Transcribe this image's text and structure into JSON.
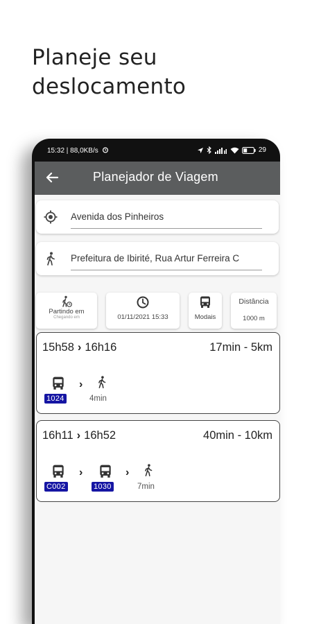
{
  "headline": {
    "line1": "Planeje seu",
    "line2": "deslocamento"
  },
  "status_bar": {
    "left": "15:32 | 88,0KB/s",
    "battery": "29"
  },
  "app_bar": {
    "title": "Planejador de Viagem"
  },
  "origin": {
    "value": "Avenida dos Pinheiros",
    "icon": "my-location-icon"
  },
  "destination": {
    "value": "Prefeitura de Ibirité, Rua Artur Ferreira C",
    "icon": "walking-icon"
  },
  "options": {
    "departure": {
      "label": "Partindo em",
      "sub": "Chegando em"
    },
    "datetime": {
      "value": "01/11/2021 15:33"
    },
    "modes": {
      "label": "Modais"
    },
    "distance": {
      "label": "Distância",
      "value": "1000 m"
    }
  },
  "trips": [
    {
      "start": "15h58",
      "end": "16h16",
      "summary": "17min - 5km",
      "lines": [
        "1024"
      ],
      "walk": "4min"
    },
    {
      "start": "16h11",
      "end": "16h52",
      "summary": "40min - 10km",
      "lines": [
        "C002",
        "1030"
      ],
      "walk": "7min"
    }
  ],
  "colors": {
    "app_bar": "#5b5d5e",
    "badge": "#1515a3",
    "background": "#f6f6f6"
  }
}
